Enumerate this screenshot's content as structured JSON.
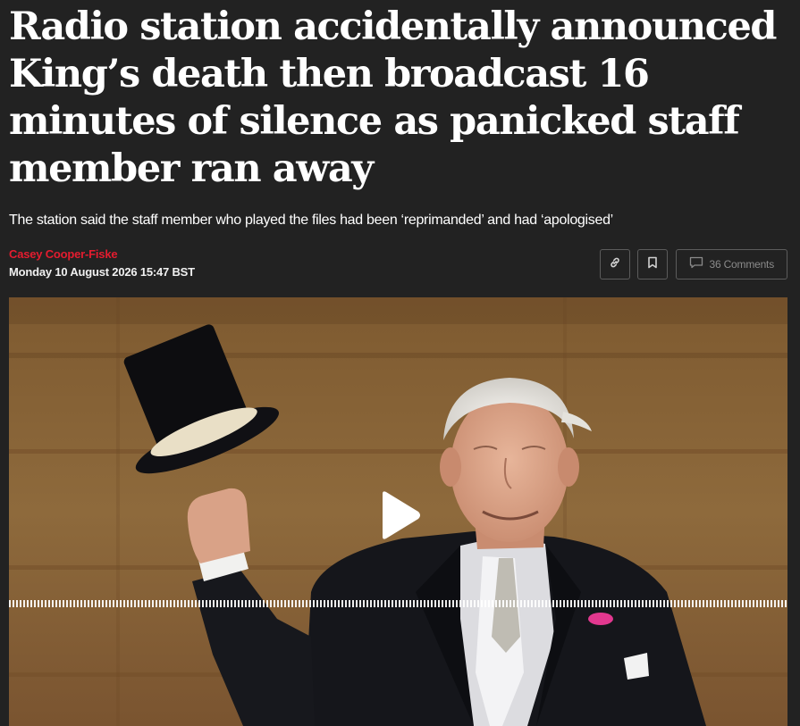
{
  "article": {
    "headline": "Radio station accidentally announced King’s death then broadcast 16 minutes of silence as panicked staff member ran away",
    "standfirst": "The station said the staff member who played the files had been ‘reprimanded’ and had ‘apologised’",
    "author": "Casey Cooper-Fiske",
    "date": "Monday 10 August 2026 15:47 BST"
  },
  "actions": {
    "copy_link_icon": "link-icon",
    "bookmark_icon": "bookmark-icon",
    "comments_icon": "speech-bubble-icon",
    "comments_label": "36 Comments"
  },
  "media": {
    "type": "video",
    "play_icon": "play-icon"
  },
  "colors": {
    "background": "#222222",
    "author": "#e41c2f",
    "text": "#ffffff"
  }
}
